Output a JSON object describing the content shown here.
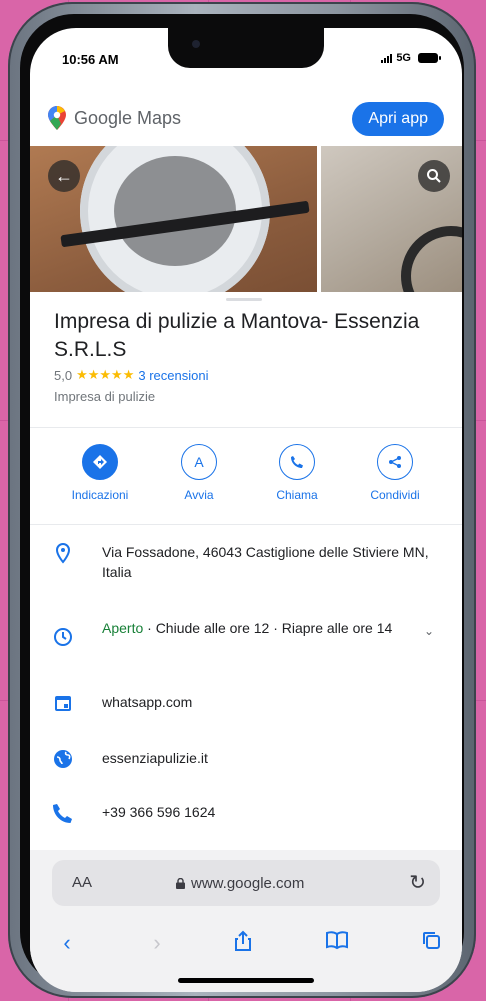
{
  "status_bar": {
    "time": "10:56 AM",
    "network": "5G"
  },
  "header": {
    "logo_text": "Google Maps",
    "open_app_label": "Apri app"
  },
  "photos": {
    "back_icon": "arrow-left-icon",
    "search_icon": "search-icon"
  },
  "place": {
    "title": "Impresa di pulizie a Mantova- Essenzia S.R.L.S",
    "rating": "5,0",
    "stars": "★★★★★",
    "reviews": "3 recensioni",
    "category": "Impresa di pulizie"
  },
  "actions": [
    {
      "label": "Indicazioni",
      "icon": "directions-icon"
    },
    {
      "label": "Avvia",
      "icon": "navigation-icon"
    },
    {
      "label": "Chiama",
      "icon": "phone-icon"
    },
    {
      "label": "Condividi",
      "icon": "share-icon"
    }
  ],
  "info": {
    "address": "Via Fossadone, 46043 Castiglione delle Stiviere MN, Italia",
    "hours_status": "Aperto",
    "hours_detail": " · Chiude alle ore 12 · Riapre alle ore 14",
    "booking": "whatsapp.com",
    "website": "essenziapulizie.it",
    "phone": "+39 366 596 1624"
  },
  "browser": {
    "text_size": "AA",
    "url": "www.google.com"
  },
  "colors": {
    "accent": "#1a73e8",
    "open": "#188038",
    "stars": "#fbbc04"
  }
}
